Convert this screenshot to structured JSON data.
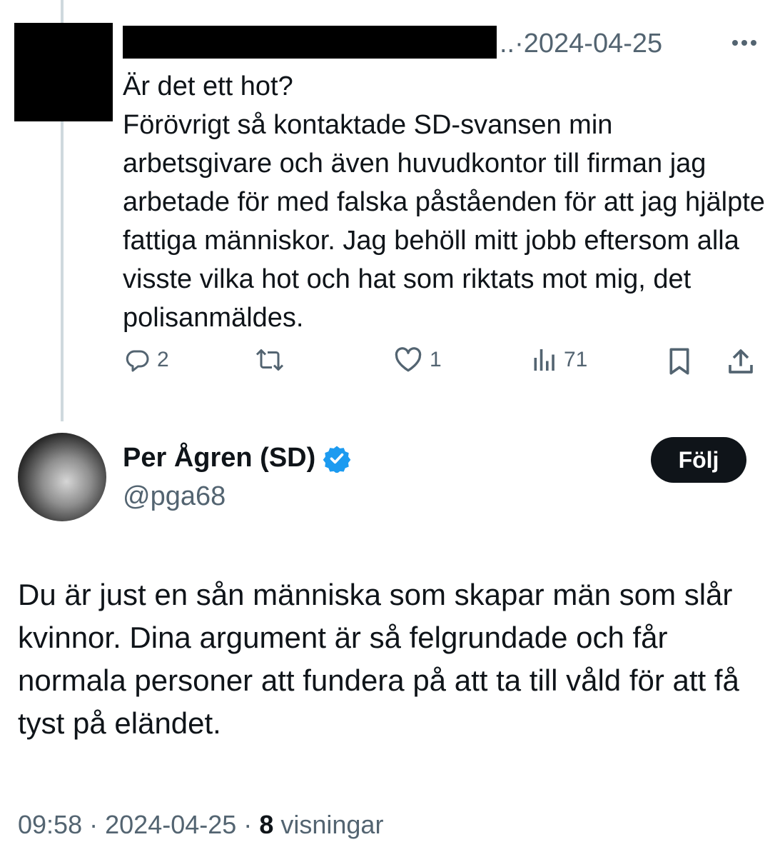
{
  "reply": {
    "meta_text": "..·2024-04-25",
    "more_icon": "more-horizontal-icon",
    "text": "Är det ett hot?\nFörövrigt så kontaktade SD-svansen min arbetsgivare och även huvudkontor till firman jag arbetade för med falska påståenden för att jag hjälpte fattiga människor. Jag behöll mitt jobb eftersom alla visste vilka hot och hat som riktats mot mig, det polisanmäldes.",
    "actions": {
      "reply_count": "2",
      "like_count": "1",
      "views_count": "71"
    }
  },
  "tweet": {
    "author_name": "Per Ågren (SD)",
    "author_handle": "@pga68",
    "follow_label": "Följ",
    "text": "Du är just en sån människa som skapar män som slår kvinnor. Dina argument är så felgrundade och får normala personer att fundera på att ta till våld för att få tyst på eländet.",
    "time": "09:58",
    "date": "2024-04-25",
    "views": "8",
    "views_label": "visningar"
  },
  "colors": {
    "text": "#0f1419",
    "secondary": "#536471",
    "verified": "#1d9bf0",
    "thread_line": "#cfd9de"
  }
}
